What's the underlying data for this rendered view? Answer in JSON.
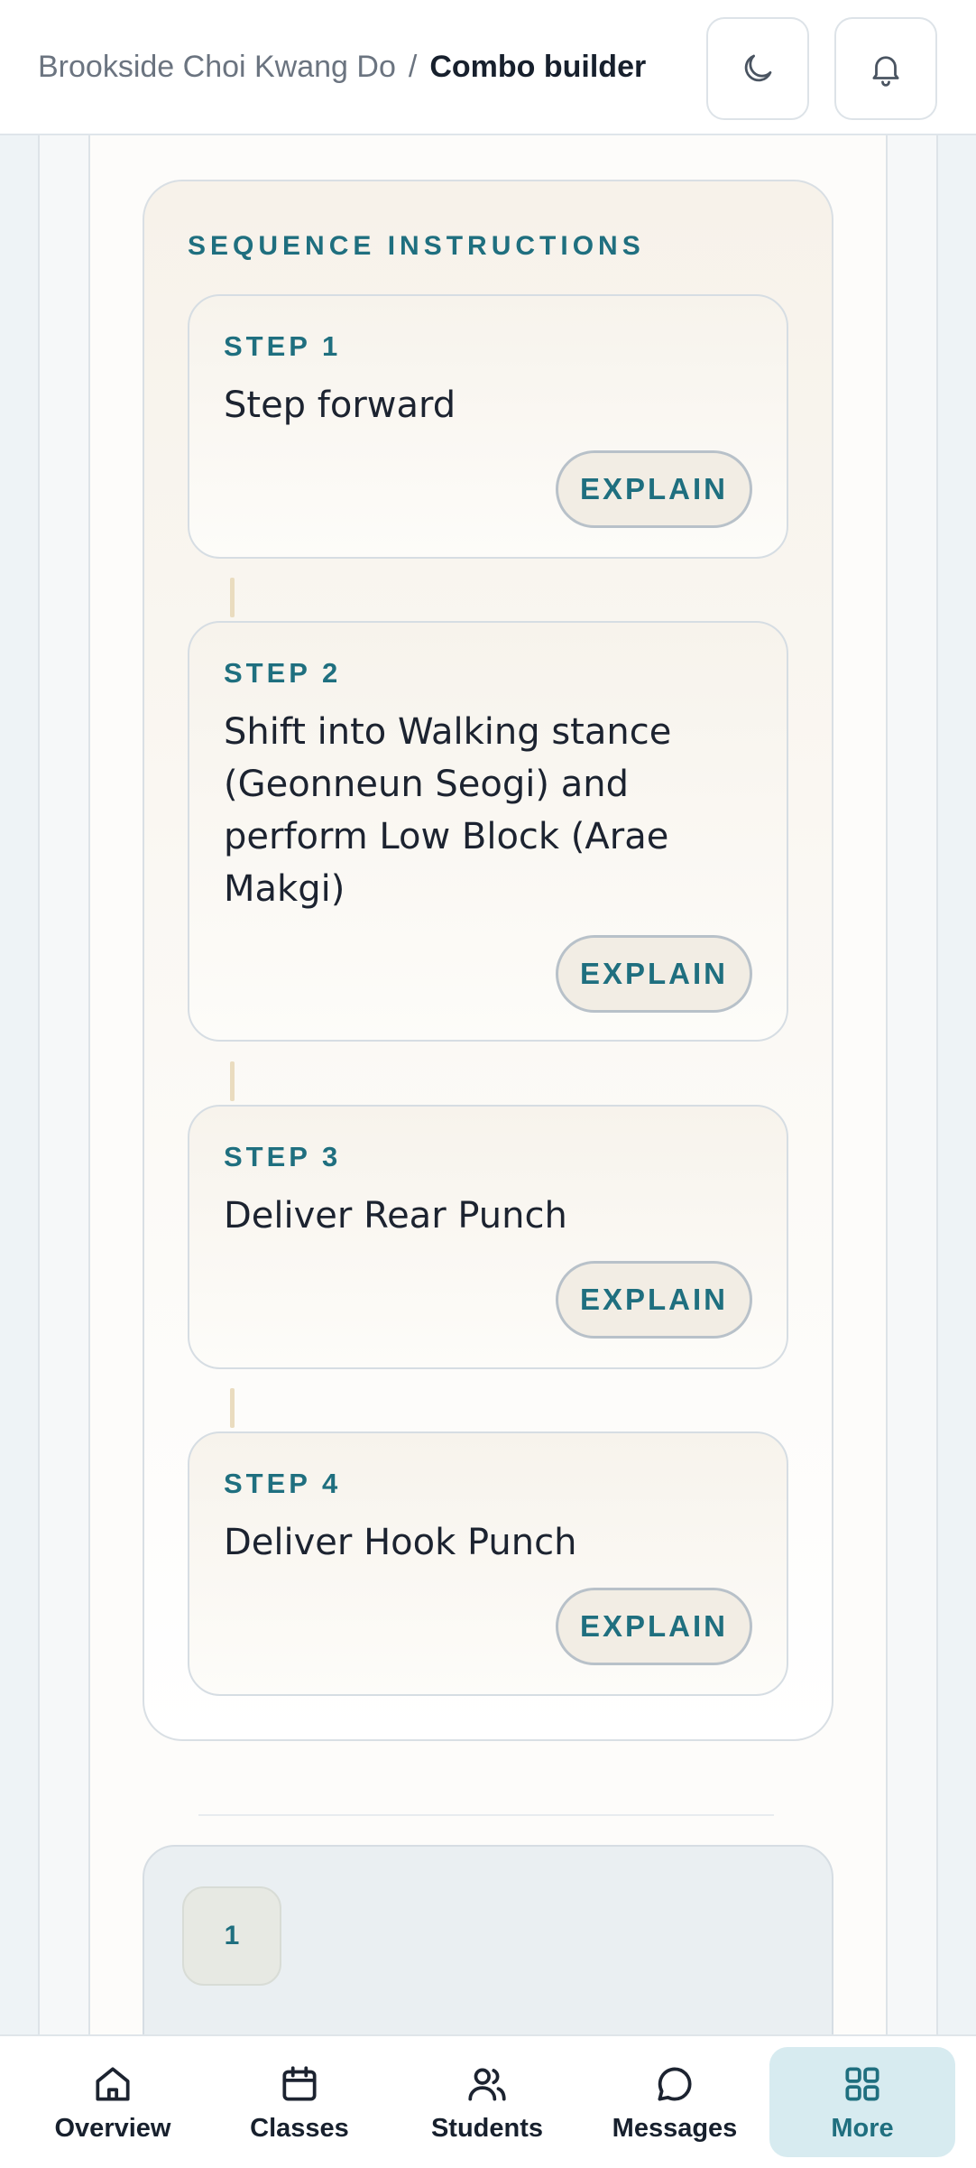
{
  "header": {
    "breadcrumb_parent": "Brookside Choi Kwang Do",
    "breadcrumb_separator": "/",
    "breadcrumb_current": "Combo builder",
    "theme_icon": "moon-icon",
    "notification_icon": "bell-icon"
  },
  "sequence": {
    "title": "SEQUENCE INSTRUCTIONS",
    "steps": [
      {
        "label": "STEP 1",
        "text": "Step forward",
        "button": "EXPLAIN"
      },
      {
        "label": "STEP 2",
        "text": "Shift into Walking stance (Geonneun Seogi) and perform Low Block (Arae Makgi)",
        "button": "EXPLAIN"
      },
      {
        "label": "STEP 3",
        "text": "Deliver Rear Punch",
        "button": "EXPLAIN"
      },
      {
        "label": "STEP 4",
        "text": "Deliver Hook Punch",
        "button": "EXPLAIN"
      }
    ]
  },
  "next_card": {
    "number": "1"
  },
  "nav": {
    "items": [
      {
        "label": "Overview",
        "icon": "home-icon"
      },
      {
        "label": "Classes",
        "icon": "calendar-icon"
      },
      {
        "label": "Students",
        "icon": "users-icon"
      },
      {
        "label": "Messages",
        "icon": "chat-icon"
      },
      {
        "label": "More",
        "icon": "grid-icon",
        "active": true
      }
    ]
  },
  "colors": {
    "accent": "#1f6f7f",
    "active_nav_bg": "#d7ebf0",
    "connector": "#eadcbf"
  }
}
